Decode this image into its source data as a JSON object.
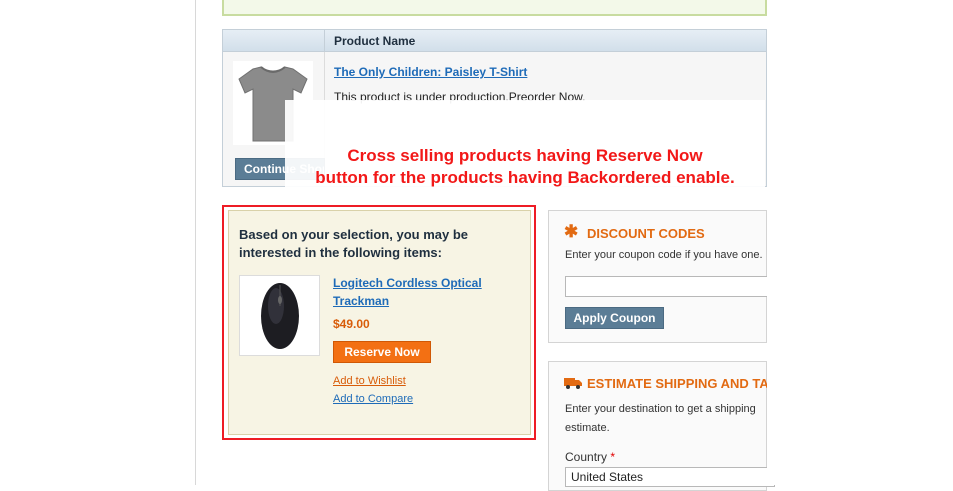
{
  "cart": {
    "column_header": "Product Name",
    "item": {
      "name": "The Only Children: Paisley T-Shirt",
      "note": "This product is under production.Preorder Now.",
      "image_icon": "tshirt-image"
    },
    "continue_button": "Continue Shopping"
  },
  "annotation": {
    "line1": "Cross selling products having Reserve Now",
    "line2": "button for the products having Backordered enable."
  },
  "crosssell": {
    "heading": "Based on your selection, you may be interested in the following items:",
    "product": {
      "name": "Logitech Cordless Optical Trackman",
      "price": "$49.00",
      "image_icon": "mouse-image"
    },
    "reserve_button": "Reserve Now",
    "wishlist_link": "Add to Wishlist",
    "compare_link": "Add to Compare"
  },
  "discount": {
    "title": "DISCOUNT CODES",
    "help": "Enter your coupon code if you have one.",
    "coupon_value": "",
    "apply_button": "Apply Coupon"
  },
  "shipping": {
    "title": "ESTIMATE SHIPPING AND TAX",
    "help": "Enter your destination to get a shipping estimate.",
    "country_label": "Country",
    "required_mark": "*",
    "country_value": "United States"
  },
  "colors": {
    "annotation_red": "#f21818",
    "accent_orange": "#f37013",
    "link_blue": "#1e6bb8",
    "button_slate": "#5b7d96"
  }
}
